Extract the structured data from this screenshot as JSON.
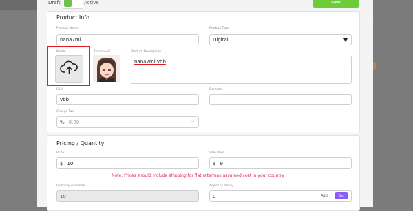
{
  "header": {
    "draft_label": "Draft",
    "active_label": "Active",
    "save_label": "Save"
  },
  "product_info": {
    "title": "Product Info",
    "product_name": {
      "label": "Product Name",
      "value": "nana7mi"
    },
    "product_type": {
      "label": "Product Type",
      "value": "Digital"
    },
    "model": {
      "label": "Model"
    },
    "thumbnail": {
      "label": "Thumbnail"
    },
    "description": {
      "label": "Product Description",
      "value": "nana7mi ybb"
    },
    "sku": {
      "label": "SKU",
      "value": "ybb"
    },
    "barcode": {
      "label": "Barcode",
      "value": ""
    },
    "charge_tax": {
      "label": "Charge Tax",
      "prefix": "%",
      "placeholder": "0.00"
    }
  },
  "pricing": {
    "title": "Pricing / Quantity",
    "price": {
      "label": "Price",
      "prefix": "$",
      "value": "10"
    },
    "sale_price": {
      "label": "Sale Price",
      "prefix": "$",
      "value": "9"
    },
    "note": "Note: Prices should include shipping for flat rate/max assumed cost in your country.",
    "quantity_available": {
      "label": "Quantity Available",
      "value": "10"
    },
    "adjust_quantity": {
      "label": "Adjust Quantity",
      "value": "0",
      "add_label": "Add",
      "set_label": "Set"
    }
  },
  "colors": {
    "accent_green": "#6ecb3a",
    "highlight_red": "#e11d25",
    "set_purple": "#8b5cf6",
    "note_red": "#d9284b"
  },
  "icons": {
    "upload": "cloud-upload-icon",
    "select": "chevron-down-icon",
    "check": "check-icon"
  }
}
